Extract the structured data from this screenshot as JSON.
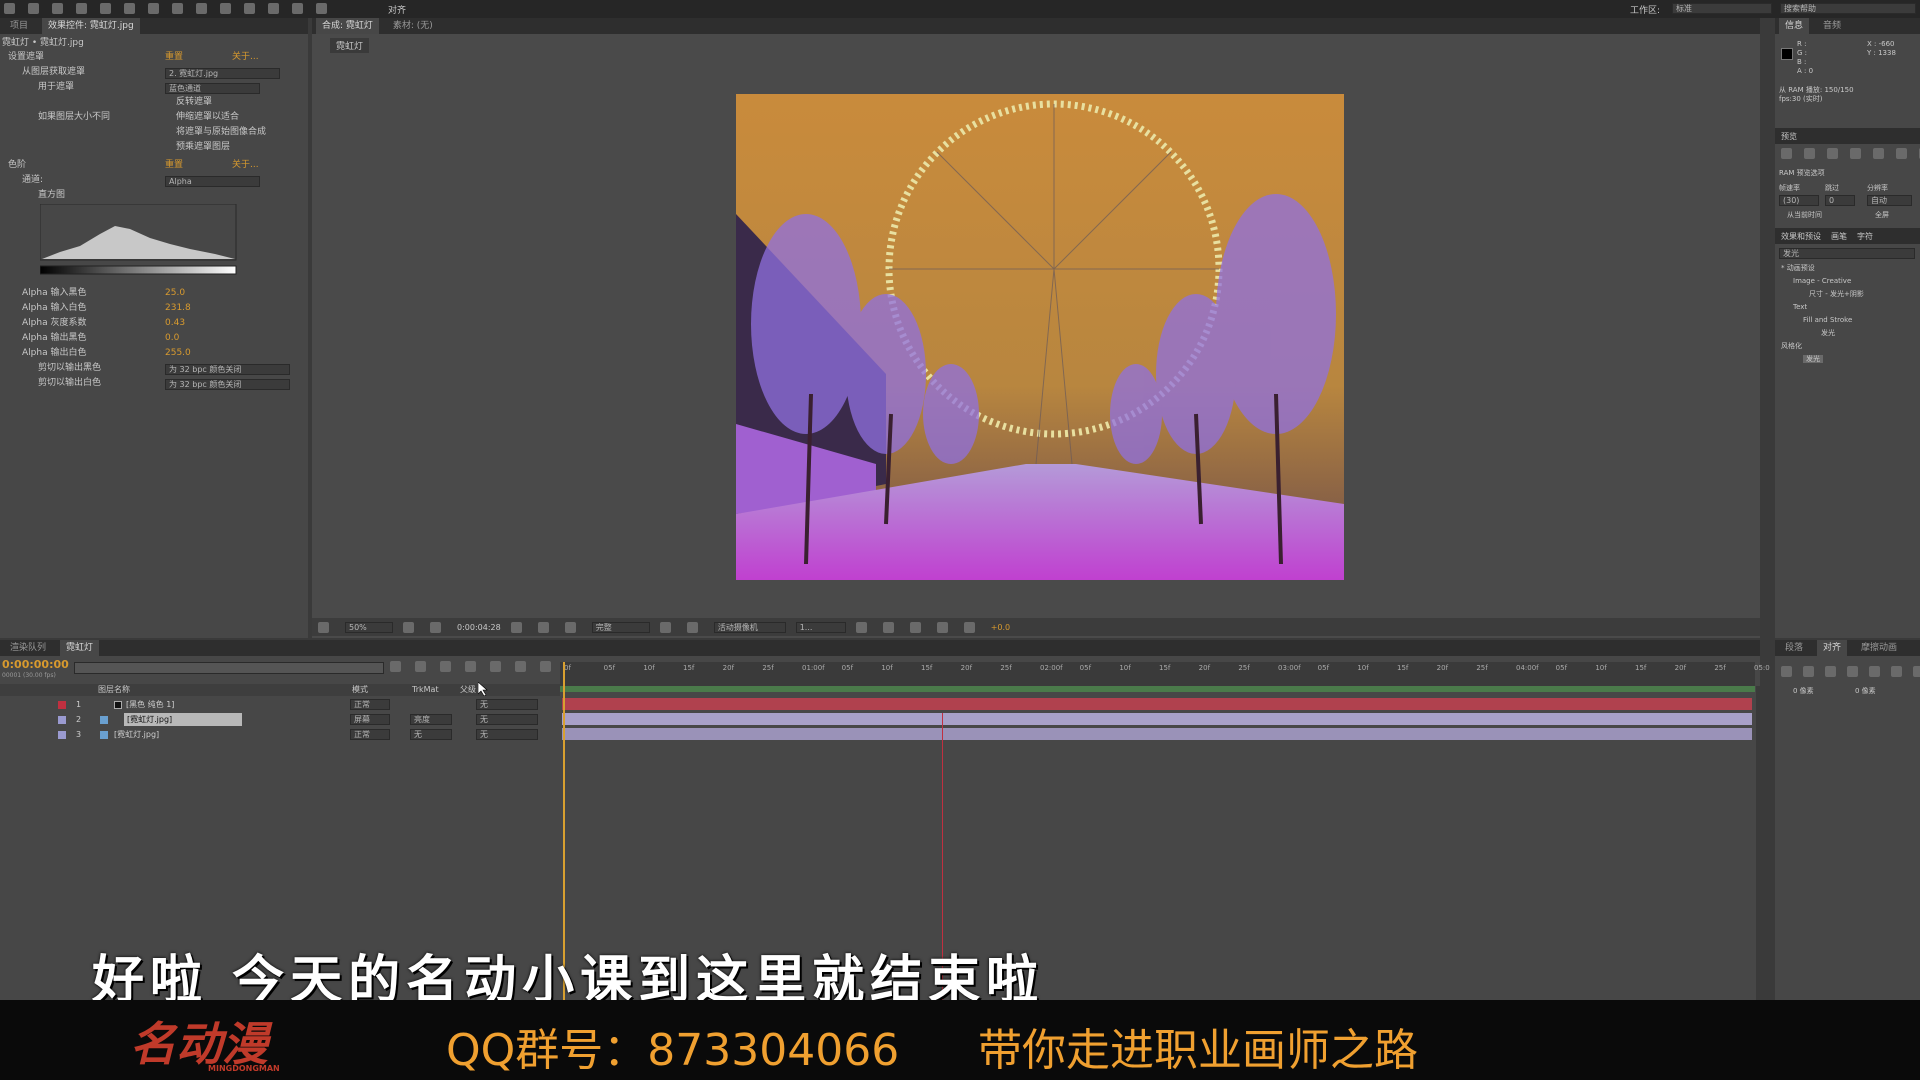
{
  "menubar": {
    "align": "对齐",
    "workspace_label": "工作区:",
    "workspace_value": "标准",
    "search_help": "搜索帮助"
  },
  "effects_panel": {
    "tab_project": "项目",
    "tab_effect": "效果控件: 霓虹灯.jpg",
    "layer_path": "霓虹灯 • 霓虹灯.jpg",
    "fx1_name": "设置遮罩",
    "reset": "重置",
    "about": "关于...",
    "get_mask_from_label": "从图层获取遮罩",
    "get_mask_from_value": "2. 霓虹灯.jpg",
    "use_for_label": "用于遮罩",
    "use_for_value": "蓝色通道",
    "invert": "反转遮罩",
    "if_size_differ_label": "如果图层大小不同",
    "stretch": "伸缩遮罩以适合",
    "composite": "将遮罩与原始图像合成",
    "premultiply": "预乘遮罩图层",
    "fx2_name": "色阶",
    "channel_label": "通道:",
    "channel_value": "Alpha",
    "histogram_label": "直方图",
    "params": [
      {
        "label": "Alpha 输入黑色",
        "value": "25.0"
      },
      {
        "label": "Alpha 输入白色",
        "value": "231.8"
      },
      {
        "label": "Alpha 灰度系数",
        "value": "0.43"
      },
      {
        "label": "Alpha 输出黑色",
        "value": "0.0"
      },
      {
        "label": "Alpha 输出白色",
        "value": "255.0"
      }
    ],
    "clip_black_label": "剪切以输出黑色",
    "clip_white_label": "剪切以输出白色",
    "clip_value": "为 32 bpc 颜色关闭"
  },
  "comp_panel": {
    "tab": "合成: 霓虹灯",
    "footage": "素材: (无)",
    "breadcrumb": "霓虹灯",
    "zoom": "50%",
    "timecode": "0:00:04:28",
    "quality": "完整",
    "camera": "活动摄像机",
    "views": "1...",
    "exposure": "+0.0"
  },
  "right_panel": {
    "tab_info": "信息",
    "tab_audio": "音频",
    "r": "R :",
    "g": "G :",
    "b": "B :",
    "a": "A : 0",
    "x": "X : -660",
    "y": "Y : 1338",
    "ram_info": "从 RAM 播放: 150/150",
    "fps": "fps:30 (实时)",
    "tab_preview": "预览",
    "ram_options": "RAM 预览选项",
    "framerate_label": "帧速率",
    "skip_label": "跳过",
    "resolution_label": "分辨率",
    "framerate_value": "(30)",
    "skip_value": "0",
    "resolution_value": "自动",
    "from_current": "从当前时间",
    "fullscreen": "全屏",
    "tab_effects": "效果和预设",
    "tab_char": "画笔",
    "tab_para": "字符",
    "search_value": "发光",
    "tree": [
      "* 动画预设",
      "Image - Creative",
      "尺寸 - 发光+阴影",
      "Text",
      "Fill and Stroke",
      "发光",
      "风格化",
      "发光"
    ]
  },
  "timeline": {
    "tab_render": "渲染队列",
    "tab_comp": "霓虹灯",
    "timecode": "0:00:00:00",
    "fps": "00001 (30.00 fps)",
    "col_layer": "图层名称",
    "col_mode": "模式",
    "col_trkmat": "TrkMat",
    "col_parent": "父级",
    "layers": [
      {
        "num": "1",
        "name": "[黑色 纯色 1]",
        "mode": "正常",
        "trk": "",
        "parent": "无"
      },
      {
        "num": "2",
        "name": "[霓虹灯.jpg]",
        "mode": "屏幕",
        "trk": "亮度",
        "parent": "无"
      },
      {
        "num": "3",
        "name": "[霓虹灯.jpg]",
        "mode": "正常",
        "trk": "无",
        "parent": "无"
      }
    ],
    "ticks": [
      "0f",
      "05f",
      "10f",
      "15f",
      "20f",
      "25f",
      "01:00f",
      "05f",
      "10f",
      "15f",
      "20f",
      "25f",
      "02:00f",
      "05f",
      "10f",
      "15f",
      "20f",
      "25f",
      "03:00f",
      "05f",
      "10f",
      "15f",
      "20f",
      "25f",
      "04:00f",
      "05f",
      "10f",
      "15f",
      "20f",
      "25f",
      "05:0"
    ]
  },
  "align_panel": {
    "tab1": "段落",
    "tab2": "对齐",
    "tab3": "摩擦动画",
    "px1": "0 像素",
    "px2": "0 像素"
  },
  "subtitle": "好啦 今天的名动小课到这里就结束啦",
  "banner": {
    "logo": "名动漫",
    "logo_sub": "MINGDONGMAN",
    "qq": "QQ群号：873304066",
    "slogan": "带你走进职业画师之路"
  },
  "colors": {
    "orange": "#d89a2e",
    "banner_text": "#f0a030",
    "panel": "#474747"
  }
}
